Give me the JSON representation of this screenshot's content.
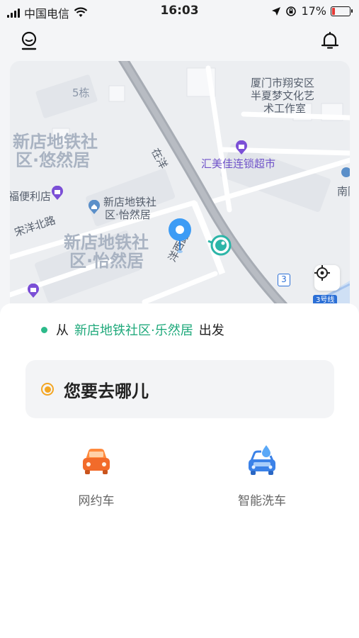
{
  "status_bar": {
    "carrier": "中国电信",
    "time": "16:03",
    "battery": "17%",
    "battery_level": 0.17
  },
  "header": {
    "profile_icon": "user-icon",
    "notification_icon": "bell-icon"
  },
  "map": {
    "labels": {
      "bldg_5": "5栋",
      "xiamen_line1": "厦门市翔安区",
      "xiamen_line2": "半夏梦文化艺",
      "xiamen_line3": "术工作室",
      "district1_line1": "新店地铁社",
      "district1_line2": "区·悠然居",
      "poi_supermarket": "汇美佳连锁超市",
      "poi_convenience": "福便利店",
      "district2_line1": "新店地铁社",
      "district2_line2": "区·怡然居",
      "district3_line1": "新店地铁社",
      "district3_line2": "区·怡然居",
      "road_songyang": "宋洋北路",
      "road_zaiyang": "在洋",
      "road_yangxi": "洋西路",
      "road_nan": "南阳",
      "road_number": "3",
      "road_chip": "3号线"
    },
    "locate_icon": "crosshair-icon"
  },
  "trip": {
    "from_prefix": "从",
    "from_name": "新店地铁社区·乐然居",
    "from_suffix": "出发",
    "destination_placeholder": "您要去哪儿"
  },
  "services": [
    {
      "label": "网约车",
      "icon": "car-icon"
    },
    {
      "label": "智能洗车",
      "icon": "car-wash-icon"
    }
  ],
  "colors": {
    "accent_green": "#1fa97b",
    "accent_orange": "#f3a623",
    "pin_blue": "#3d9cf5",
    "poi_purple": "#7b4fd6"
  }
}
